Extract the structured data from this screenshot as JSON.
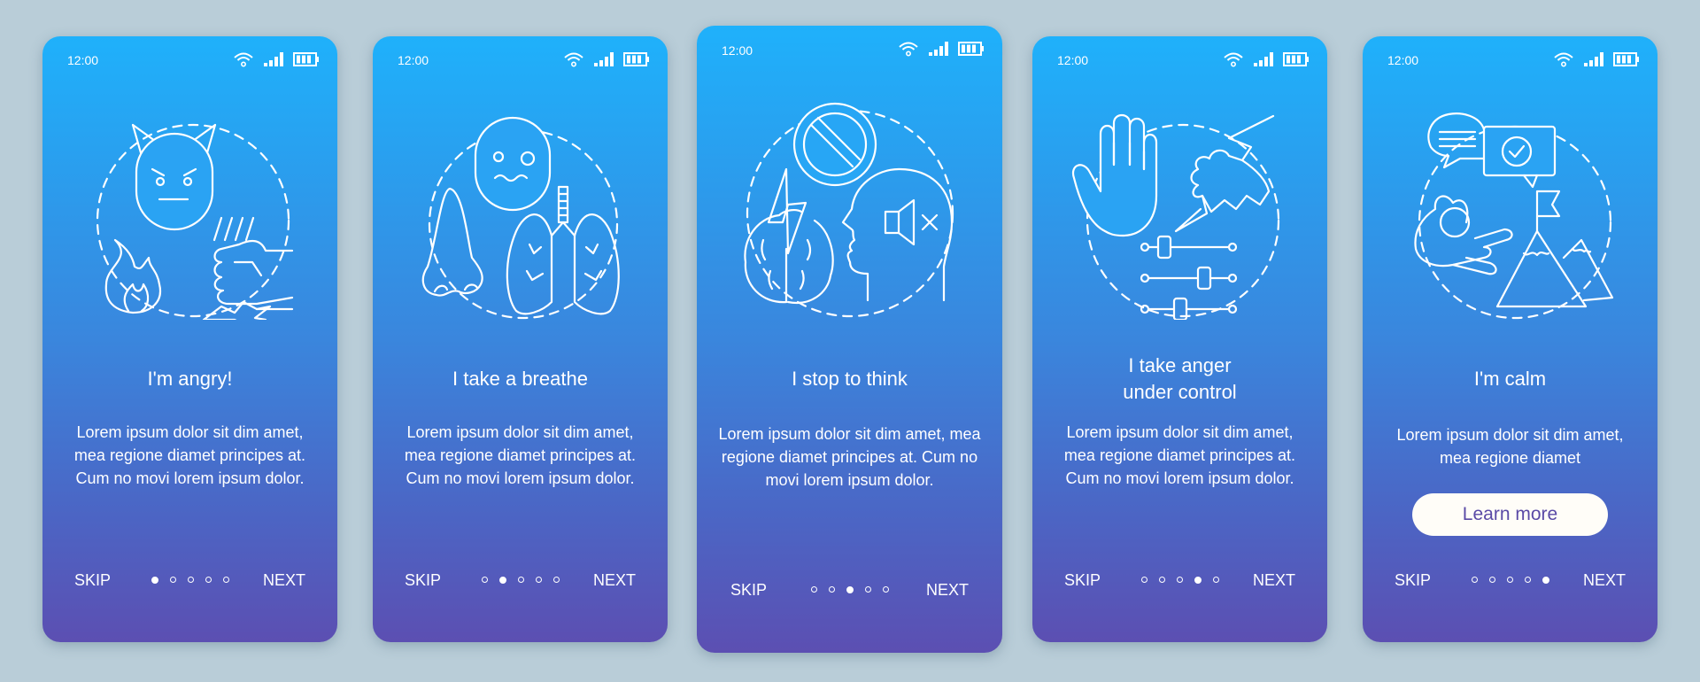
{
  "theme": {
    "background": "#b9cdd8",
    "gradient_top": "#1fb1fb",
    "gradient_bottom": "#5c4fb2",
    "button_bg": "#fffdf8",
    "button_text": "#5a4aa6"
  },
  "status_bar": {
    "time": "12:00",
    "icons": [
      "wifi-icon",
      "signal-icon",
      "battery-icon"
    ]
  },
  "nav": {
    "skip_label": "SKIP",
    "next_label": "NEXT",
    "total_steps": 5
  },
  "screens": [
    {
      "step": 1,
      "illustration": [
        "devil-face-icon",
        "fire-icon",
        "fist-smash-icon"
      ],
      "title": "I'm angry!",
      "description": "Lorem ipsum dolor sit dim amet, mea regione diamet principes at. Cum no movi lorem ipsum dolor."
    },
    {
      "step": 2,
      "illustration": [
        "anxious-face-icon",
        "nose-icon",
        "lungs-icon"
      ],
      "title": "I take a breathe",
      "description": "Lorem ipsum dolor sit dim amet, mea regione diamet principes at. Cum no movi lorem ipsum dolor."
    },
    {
      "step": 3,
      "illustration": [
        "prohibited-icon",
        "brain-lightning-icon",
        "head-muted-icon"
      ],
      "title": "I stop to think",
      "description": "Lorem ipsum dolor sit dim amet, mea regione diamet principes at. Cum no movi lorem ipsum dolor."
    },
    {
      "step": 4,
      "illustration": [
        "stop-hand-icon",
        "fist-lightning-icon",
        "sliders-icon"
      ],
      "title_line1": "I take anger",
      "title_line2": "under control",
      "description": "Lorem ipsum dolor sit dim amet, mea regione diamet principes at. Cum no movi lorem ipsum dolor."
    },
    {
      "step": 5,
      "illustration": [
        "speech-bubbles-check-icon",
        "meditation-hand-icon",
        "mountain-flag-icon"
      ],
      "title": "I'm calm",
      "description": "Lorem ipsum dolor sit dim amet, mea regione diamet",
      "button_label": "Learn more"
    }
  ]
}
